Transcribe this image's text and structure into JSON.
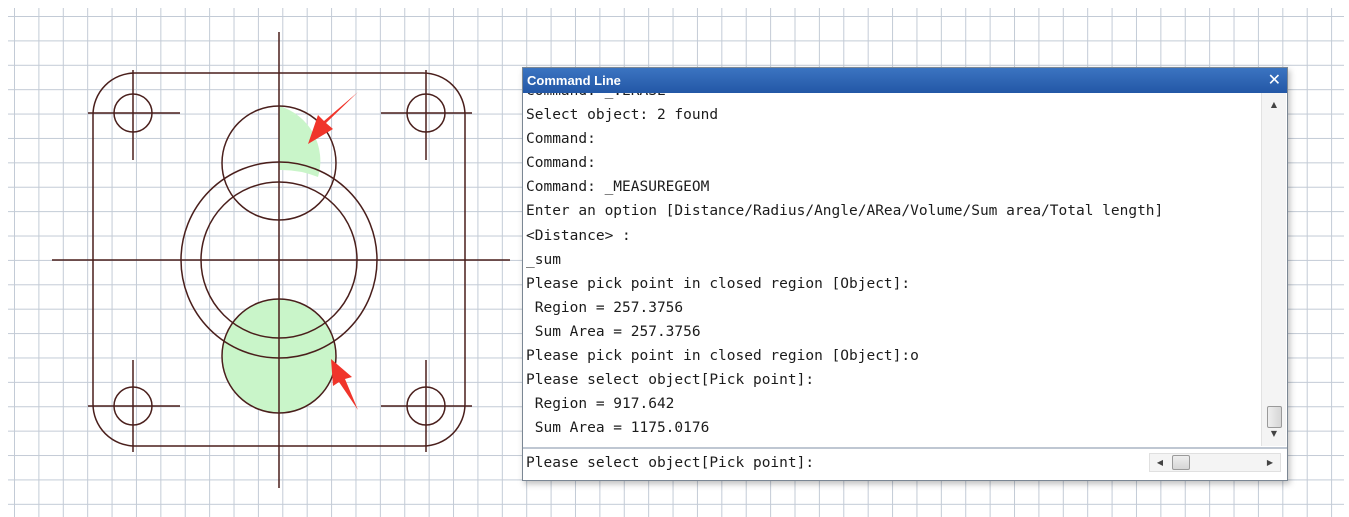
{
  "drawing": {
    "colors": {
      "line": "#4a1f1c",
      "fill": "#c9f5c9",
      "arrow": "#f0352b",
      "grid": "#c3cbd6"
    }
  },
  "command_window": {
    "title": "Command Line",
    "close_icon": "close-icon",
    "history": [
      "Command: _.ERASE",
      "Select object: 2 found",
      "Command:",
      "Command:",
      "Command: _MEASUREGEOM",
      "Enter an option [Distance/Radius/Angle/ARea/Volume/Sum area/Total length]",
      "<Distance> :",
      "_sum",
      "Please pick point in closed region [Object]:",
      " Region = 257.3756",
      " Sum Area = 257.3756",
      "Please pick point in closed region [Object]:o",
      "Please select object[Pick point]:",
      " Region = 917.642",
      " Sum Area = 1175.0176"
    ],
    "prompt": "Please select object[Pick point]:",
    "scrollbar": {
      "up_icon": "scroll-up-arrow-icon",
      "down_icon": "scroll-down-arrow-icon",
      "left_icon": "scroll-left-arrow-icon",
      "right_icon": "scroll-right-arrow-icon"
    }
  }
}
